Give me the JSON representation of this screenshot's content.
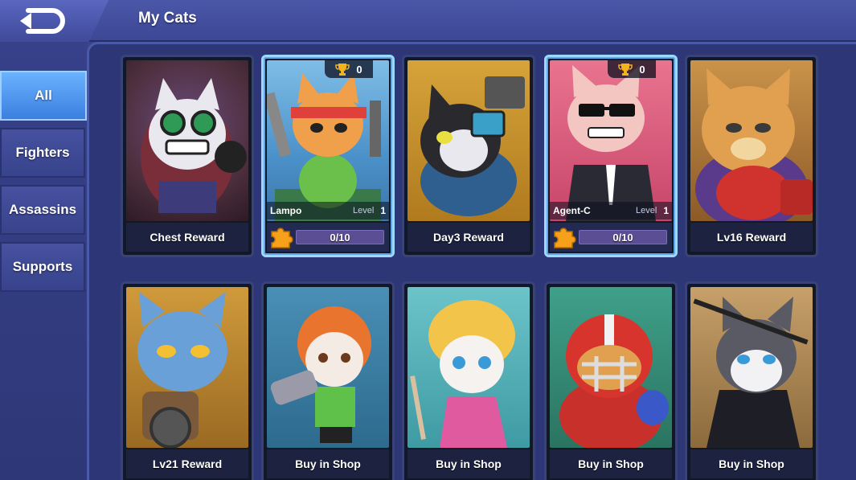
{
  "header": {
    "title": "My Cats",
    "back_icon": "back-arrow-icon"
  },
  "sidebar": {
    "tabs": [
      {
        "label": "All",
        "active": true
      },
      {
        "label": "Fighters",
        "active": false
      },
      {
        "label": "Assassins",
        "active": false
      },
      {
        "label": "Supports",
        "active": false
      }
    ]
  },
  "cards": [
    {
      "label": "Chest Reward"
    },
    {
      "name": "Lampo",
      "level_label": "Level",
      "level": "1",
      "trophies": "0",
      "progress": "0/10",
      "owned": true
    },
    {
      "label": "Day3 Reward"
    },
    {
      "name": "Agent-C",
      "level_label": "Level",
      "level": "1",
      "trophies": "0",
      "progress": "0/10",
      "owned": true
    },
    {
      "label": "Lv16 Reward"
    },
    {
      "label": "Lv21 Reward"
    },
    {
      "label": "Buy in Shop"
    },
    {
      "label": "Buy in Shop"
    },
    {
      "label": "Buy in Shop"
    },
    {
      "label": "Buy in Shop"
    }
  ],
  "colors": {
    "active_tab": "#4a92ec",
    "owned_border": "#9fd8ff",
    "progress_bar": "#5b4e95",
    "trophy": "#f5b21b",
    "puzzle": "#f7a11a"
  }
}
